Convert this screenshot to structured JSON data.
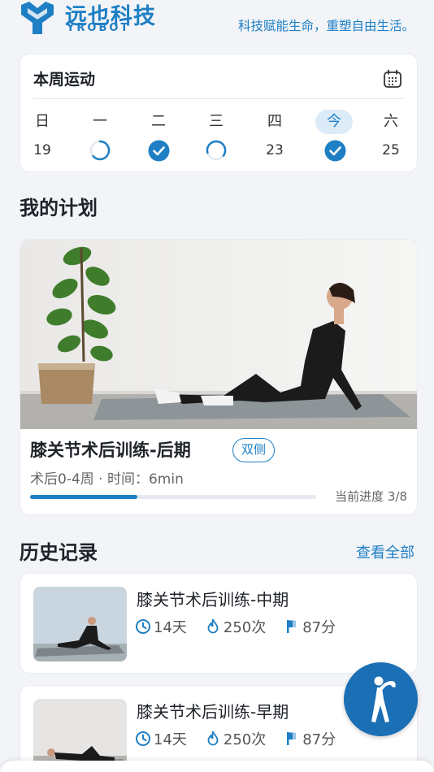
{
  "brand": {
    "name_cn": "远也科技",
    "name_en": "YROBOT",
    "slogan": "科技赋能生命，重塑自由生活。"
  },
  "week": {
    "title": "本周运动",
    "icon": "calendar-icon",
    "days": [
      {
        "label": "日",
        "value": "19",
        "status": "none"
      },
      {
        "label": "一",
        "value": "",
        "status": "partial"
      },
      {
        "label": "二",
        "value": "",
        "status": "done"
      },
      {
        "label": "三",
        "value": "",
        "status": "partial"
      },
      {
        "label": "四",
        "value": "23",
        "status": "none"
      },
      {
        "label": "今",
        "value": "",
        "status": "done",
        "today": true
      },
      {
        "label": "六",
        "value": "25",
        "status": "none"
      }
    ]
  },
  "plan": {
    "section_title": "我的计划",
    "name": "膝关节术后训练-后期",
    "tag": "双侧",
    "subtitle": "术后0-4周 · 时间：6min",
    "progress_label": "当前进度 3/8",
    "progress_fraction": 0.375
  },
  "history": {
    "section_title": "历史记录",
    "view_all": "查看全部",
    "items": [
      {
        "name": "膝关节术后训练-中期",
        "days": "14天",
        "count": "250次",
        "score": "87分"
      },
      {
        "name": "膝关节术后训练-早期",
        "days": "14天",
        "count": "250次",
        "score": "87分"
      }
    ]
  },
  "colors": {
    "accent": "#1e7fc4",
    "fab": "#1a6fb5",
    "background": "#f2f4f8"
  }
}
